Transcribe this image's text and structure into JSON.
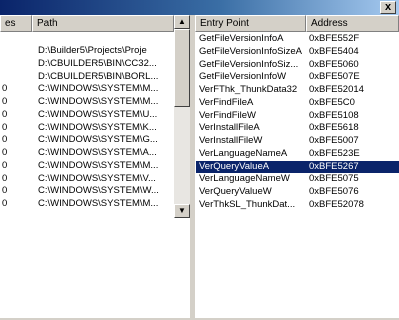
{
  "window": {
    "close_glyph": "x",
    "icons": {
      "close": "close-icon",
      "up": "scroll-up-arrow-icon",
      "down": "scroll-down-arrow-icon"
    }
  },
  "left_pane": {
    "columns": [
      "es",
      "Path"
    ],
    "rows": [
      {
        "c0": "",
        "path": "D:\\Builder5\\Projects\\Proje"
      },
      {
        "c0": "",
        "path": "D:\\CBUILDER5\\BIN\\CC32..."
      },
      {
        "c0": "",
        "path": "D:\\CBUILDER5\\BIN\\BORL..."
      },
      {
        "c0": "0",
        "path": "C:\\WINDOWS\\SYSTEM\\M..."
      },
      {
        "c0": "0",
        "path": "C:\\WINDOWS\\SYSTEM\\M..."
      },
      {
        "c0": "0",
        "path": "C:\\WINDOWS\\SYSTEM\\U..."
      },
      {
        "c0": "0",
        "path": "C:\\WINDOWS\\SYSTEM\\K..."
      },
      {
        "c0": "0",
        "path": "C:\\WINDOWS\\SYSTEM\\G..."
      },
      {
        "c0": "0",
        "path": "C:\\WINDOWS\\SYSTEM\\A..."
      },
      {
        "c0": "0",
        "path": "C:\\WINDOWS\\SYSTEM\\M..."
      },
      {
        "c0": "0",
        "path": "C:\\WINDOWS\\SYSTEM\\V..."
      },
      {
        "c0": "0",
        "path": "C:\\WINDOWS\\SYSTEM\\W..."
      },
      {
        "c0": "0",
        "path": "C:\\WINDOWS\\SYSTEM\\M..."
      }
    ]
  },
  "right_pane": {
    "columns": [
      "Entry Point",
      "Address"
    ],
    "selected_index": 10,
    "rows": [
      {
        "name": "GetFileVersionInfoA",
        "addr": "0xBFE552F"
      },
      {
        "name": "GetFileVersionInfoSizeA",
        "addr": "0xBFE5404"
      },
      {
        "name": "GetFileVersionInfoSiz...",
        "addr": "0xBFE5060"
      },
      {
        "name": "GetFileVersionInfoW",
        "addr": "0xBFE507E"
      },
      {
        "name": "VerFThk_ThunkData32",
        "addr": "0xBFE52014"
      },
      {
        "name": "VerFindFileA",
        "addr": "0xBFE5C0"
      },
      {
        "name": "VerFindFileW",
        "addr": "0xBFE5108"
      },
      {
        "name": "VerInstallFileA",
        "addr": "0xBFE5618"
      },
      {
        "name": "VerInstallFileW",
        "addr": "0xBFE5007"
      },
      {
        "name": "VerLanguageNameA",
        "addr": "0xBFE523E"
      },
      {
        "name": "VerQueryValueA",
        "addr": "0xBFE5267"
      },
      {
        "name": "VerLanguageNameW",
        "addr": "0xBFE5075"
      },
      {
        "name": "VerQueryValueW",
        "addr": "0xBFE5076"
      },
      {
        "name": "VerThkSL_ThunkDat...",
        "addr": "0xBFE52078"
      }
    ]
  },
  "colors": {
    "selection": "#0a246a",
    "chrome": "#d4d0c8"
  }
}
